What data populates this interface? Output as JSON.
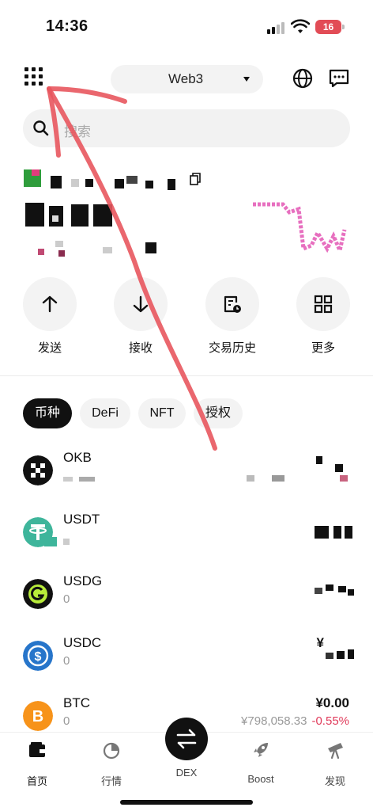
{
  "status_bar": {
    "time": "14:36",
    "battery": "16"
  },
  "header": {
    "mode_label": "Web3"
  },
  "search": {
    "placeholder": "搜索"
  },
  "actions": [
    {
      "label": "发送",
      "icon": "arrow-up-icon"
    },
    {
      "label": "接收",
      "icon": "arrow-down-icon"
    },
    {
      "label": "交易历史",
      "icon": "history-icon"
    },
    {
      "label": "更多",
      "icon": "grid-more-icon"
    }
  ],
  "tabs": [
    {
      "label": "币种",
      "active": true
    },
    {
      "label": "DeFi",
      "active": false
    },
    {
      "label": "NFT",
      "active": false
    },
    {
      "label": "授权",
      "active": false
    }
  ],
  "tokens": [
    {
      "symbol": "OKB",
      "amount": "",
      "value": "",
      "price": "",
      "change": "",
      "icon": "okb-logo-icon"
    },
    {
      "symbol": "USDT",
      "amount": "",
      "value": "",
      "price": "",
      "change": "",
      "icon": "usdt-logo-icon"
    },
    {
      "symbol": "USDG",
      "amount": "0",
      "value": "",
      "price": "",
      "change": "",
      "icon": "usdg-logo-icon"
    },
    {
      "symbol": "USDC",
      "amount": "0",
      "value": "¥",
      "price": "",
      "change": "",
      "icon": "usdc-logo-icon"
    },
    {
      "symbol": "BTC",
      "amount": "0",
      "value": "¥0.00",
      "price": "¥798,058.33",
      "change": "-0.55%",
      "icon": "btc-logo-icon"
    }
  ],
  "bottom_nav": [
    {
      "label": "首页",
      "icon": "wallet-icon",
      "active": true
    },
    {
      "label": "行情",
      "icon": "market-icon",
      "active": false
    },
    {
      "label": "DEX",
      "icon": "swap-icon",
      "active": false
    },
    {
      "label": "Boost",
      "icon": "rocket-icon",
      "active": false
    },
    {
      "label": "发现",
      "icon": "telescope-icon",
      "active": false
    }
  ],
  "colors": {
    "accent": "#111111",
    "negative": "#e03a5a",
    "annotation": "#e8575e",
    "battery": "#e24c56"
  }
}
